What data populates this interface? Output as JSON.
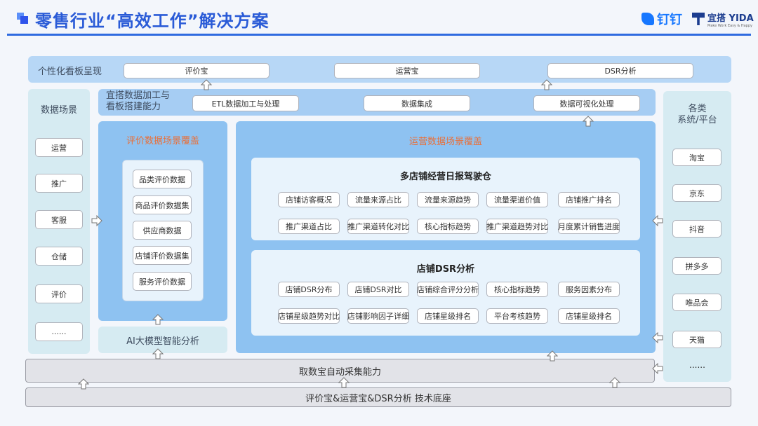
{
  "header": {
    "title": "零售行业“高效工作”解决方案",
    "brand_dingtalk": "钉钉",
    "brand_yida": "宜搭 YIDA",
    "brand_yida_sub": "Make Work Easy & Happy"
  },
  "dashboard_row": {
    "label": "个性化看板呈现",
    "items": [
      "评价宝",
      "运营宝",
      "DSR分析"
    ]
  },
  "processing_row": {
    "label": "宜搭数据加工与\n看板搭建能力",
    "items": [
      "ETL数据加工与处理",
      "数据集成",
      "数据可视化处理"
    ]
  },
  "left_scenes": {
    "title": "数据场景",
    "items": [
      "运营",
      "推广",
      "客服",
      "仓储",
      "评价",
      "......"
    ]
  },
  "review_coverage": {
    "title": "评价数据场景覆盖",
    "items": [
      "品类评价数据",
      "商品评价数据集",
      "供应商数据",
      "店铺评价数据集",
      "服务评价数据"
    ]
  },
  "ai_analysis": {
    "label": "AI大模型智能分析"
  },
  "ops_coverage": {
    "title": "运营数据场景覆盖",
    "cockpit": {
      "title": "多店铺经营日报驾驶仓",
      "row1": [
        "店铺访客概况",
        "流量来源占比",
        "流量来源趋势",
        "流量渠道价值",
        "店铺推广排名"
      ],
      "row2": [
        "推广渠道占比",
        "推广渠道转化对比",
        "核心指标趋势",
        "推广渠道趋势对比",
        "月度累计销售进度"
      ]
    },
    "dsr": {
      "title": "店铺DSR分析",
      "row1": [
        "店铺DSR分布",
        "店铺DSR对比",
        "店铺综合评分分析",
        "核心指标趋势",
        "服务因素分布"
      ],
      "row2": [
        "店铺星级趋势对比",
        "店铺影响因子详细",
        "店铺星级排名",
        "平台考核趋势",
        "店铺星级排名"
      ]
    }
  },
  "platforms": {
    "title": "各类\n系统/平台",
    "items": [
      "淘宝",
      "京东",
      "抖音",
      "拼多多",
      "唯品会",
      "天猫"
    ],
    "more": "......"
  },
  "collection_bar": {
    "label": "取数宝自动采集能力"
  },
  "foundation_bar": {
    "label": "评价宝&运营宝&DSR分析 技术底座"
  }
}
